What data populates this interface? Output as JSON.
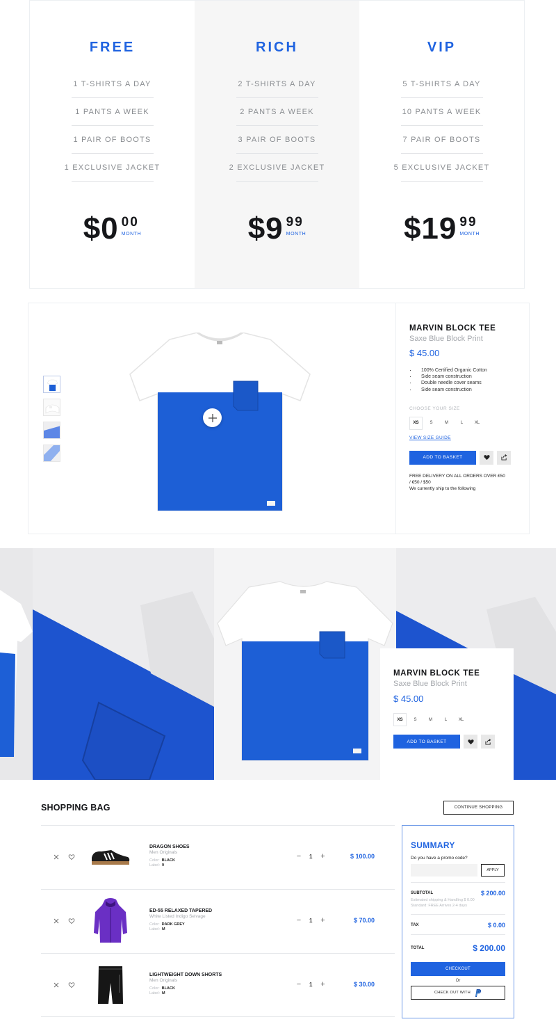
{
  "pricing": {
    "plans": [
      {
        "name": "FREE",
        "features": [
          "1 T-SHIRTS A DAY",
          "1 PANTS A WEEK",
          "1 PAIR OF BOOTS",
          "1 EXCLUSIVE JACKET"
        ],
        "price_main": "$0",
        "price_cents": "00",
        "period": "MONTH"
      },
      {
        "name": "RICH",
        "features": [
          "2 T-SHIRTS A DAY",
          "2 PANTS A WEEK",
          "3 PAIR OF BOOTS",
          "2 EXCLUSIVE JACKET"
        ],
        "price_main": "$9",
        "price_cents": "99",
        "period": "MONTH"
      },
      {
        "name": "VIP",
        "features": [
          "5 T-SHIRTS A DAY",
          "10 PANTS A WEEK",
          "7 PAIR OF BOOTS",
          "5 EXCLUSIVE JACKET"
        ],
        "price_main": "$19",
        "price_cents": "99",
        "period": "MONTH"
      }
    ]
  },
  "product": {
    "title": "MARVIN BLOCK TEE",
    "subtitle": "Saxe Blue Block Print",
    "price": "$ 45.00",
    "features": [
      "100% Certified Organic Cotton",
      "Side seam construction",
      "Double needle cover seams",
      "Side seam construction"
    ],
    "size_label": "CHOOSE YOUR SIZE",
    "sizes": [
      "XS",
      "S",
      "M",
      "L",
      "XL"
    ],
    "selected_size": "XS",
    "size_guide": "VIEW SIZE GUIDE",
    "add_to_basket": "ADD TO BASKET",
    "delivery_line1": "FREE DELIVERY ON ALL ORDERS OVER £50",
    "delivery_line2": "/ €50 / $50",
    "delivery_line3": "We currently ship to the following",
    "icons": {
      "zoom": "plus-icon",
      "wishlist": "heart-icon",
      "share": "share-icon"
    }
  },
  "gallery_card": {
    "title": "MARVIN BLOCK TEE",
    "subtitle": "Saxe Blue Block Print",
    "price": "$ 45.00",
    "sizes": [
      "XS",
      "S",
      "M",
      "L",
      "XL"
    ],
    "selected_size": "XS",
    "add_to_basket": "ADD TO BASKET"
  },
  "bag": {
    "title": "SHOPPING BAG",
    "continue": "CONTINUE SHOPPING",
    "color_label": "Color:",
    "label_label": "Label:",
    "items": [
      {
        "name": "DRAGON SHOES",
        "sub": "Men Originals",
        "color": "BLACK",
        "label": "9",
        "qty": "1",
        "total": "$ 100.00",
        "image": "sneaker"
      },
      {
        "name": "ED-55 RELAXED TAPERED",
        "sub": "White Listed Indigo Selvage",
        "color": "DARK GREY",
        "label": "M",
        "qty": "1",
        "total": "$ 70.00",
        "image": "hoodie"
      },
      {
        "name": "LIGHTWEIGHT DOWN SHORTS",
        "sub": "Men Originals",
        "color": "BLACK",
        "label": "M",
        "qty": "1",
        "total": "$ 30.00",
        "image": "shorts"
      }
    ]
  },
  "summary": {
    "title": "SUMMARY",
    "promo_label": "Do you have a promo code?",
    "promo_placeholder": "",
    "apply": "APPLY",
    "subtotal_label": "SUBTOTAL",
    "subtotal": "$ 200.00",
    "shipping_note1": "Estimated shipping & Handling $ 0.00",
    "shipping_note2": "Standard: FREE Arrives 2-4 days",
    "tax_label": "TAX",
    "tax": "$ 0.00",
    "total_label": "TOTAL",
    "total": "$ 200.00",
    "checkout": "CHECKOUT",
    "or": "Or",
    "paypal": "CHECK OUT WITH"
  },
  "colors": {
    "accent": "#1f63e0",
    "tee_blue": "#1d5fd6",
    "text_dark": "#16171a",
    "muted": "#8a8d91"
  }
}
